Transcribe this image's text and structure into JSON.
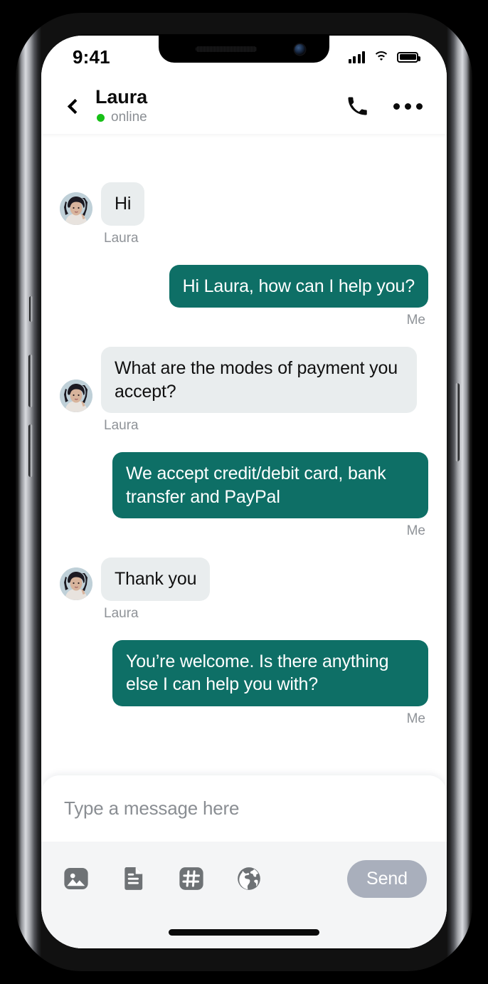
{
  "device": {
    "status_bar": {
      "time": "9:41",
      "icons": [
        "signal-bars-icon",
        "wifi-icon",
        "battery-icon"
      ]
    },
    "home_indicator": "home-indicator"
  },
  "header": {
    "back_icon": "chevron-left-icon",
    "name": "Laura",
    "status": "online",
    "status_color": "#17C017",
    "call_icon": "phone-icon",
    "more_icon": "more-dots-icon"
  },
  "conversation": {
    "contact_name": "Laura",
    "self_name": "Me",
    "messages": [
      {
        "sender": "them",
        "name": "Laura",
        "text": "Hi"
      },
      {
        "sender": "me",
        "name": "Me",
        "text": "Hi Laura, how can I help you?"
      },
      {
        "sender": "them",
        "name": "Laura",
        "text": "What are the modes of payment you accept?"
      },
      {
        "sender": "me",
        "name": "Me",
        "text": "We accept credit/debit card, bank transfer and PayPal"
      },
      {
        "sender": "them",
        "name": "Laura",
        "text": "Thank you"
      },
      {
        "sender": "me",
        "name": "Me",
        "text": "You’re welcome. Is there anything else I can help you with?"
      }
    ]
  },
  "composer": {
    "placeholder": "Type a message here",
    "value": "",
    "send_label": "Send",
    "tools": [
      {
        "name": "image-icon",
        "label": "Image"
      },
      {
        "name": "document-icon",
        "label": "Document"
      },
      {
        "name": "hashtag-icon",
        "label": "Hashtag"
      },
      {
        "name": "globe-icon",
        "label": "Globe"
      }
    ]
  },
  "colors": {
    "bubble_me": "#0E6F66",
    "bubble_them": "#E9EDEE",
    "send_button": "#A9AFBC",
    "online_dot": "#17C017",
    "toolbar_bg": "#F4F5F6"
  }
}
